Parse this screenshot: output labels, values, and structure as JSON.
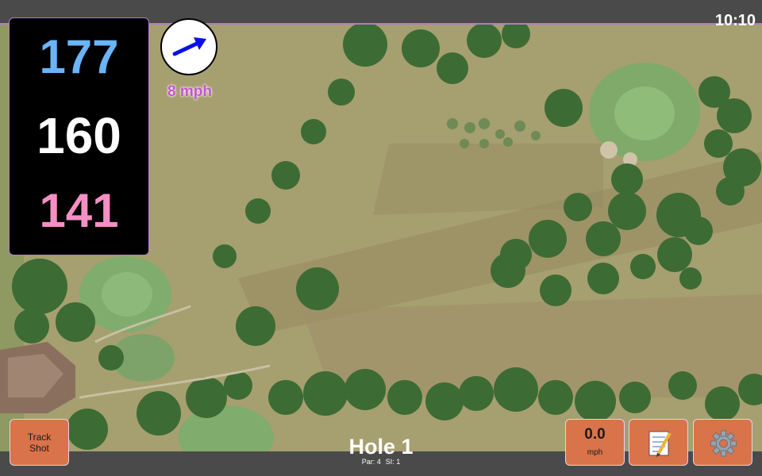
{
  "status_bar": {
    "time": "10:10"
  },
  "yardages": {
    "back": {
      "value": "177",
      "color": "#6ab4f8"
    },
    "middle": {
      "value": "160",
      "color": "#ffffff"
    },
    "front": {
      "value": "141",
      "color": "#f58fc4"
    }
  },
  "wind": {
    "speed_label": "8 mph",
    "text_color": "#c455cc",
    "arrow_icon": "arrow-up-right-icon",
    "arrow_color": "#0a10e8"
  },
  "hole": {
    "title": "Hole 1",
    "par_label": "Par: 4",
    "si_label": "SI: 1"
  },
  "buttons": {
    "track_shot": {
      "line1": "Track",
      "line2": "Shot"
    },
    "speed": {
      "value": "0.0",
      "unit": "mph"
    },
    "notes": {
      "icon": "notepad-icon"
    },
    "settings": {
      "icon": "gear-icon"
    },
    "color": "#d9734a"
  }
}
